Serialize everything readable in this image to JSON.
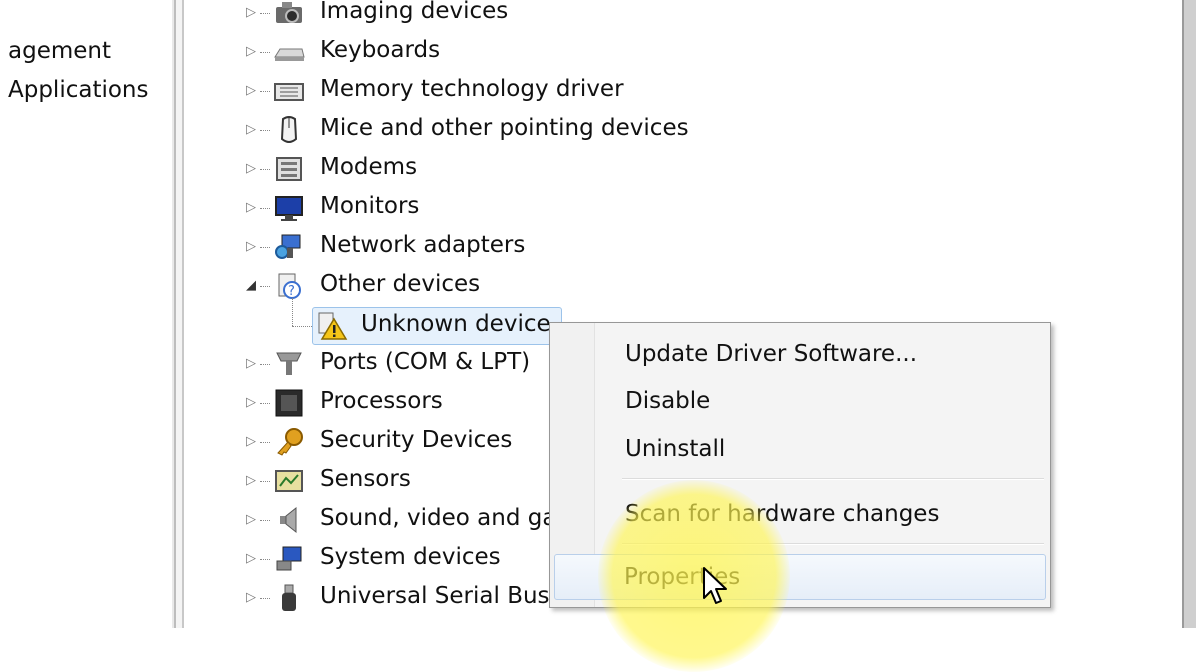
{
  "left_pane": {
    "items": [
      "agement",
      "Applications"
    ]
  },
  "tree": {
    "categories": [
      {
        "label": "Imaging devices",
        "icon": "camera-icon",
        "expanded": false
      },
      {
        "label": "Keyboards",
        "icon": "keyboard-icon",
        "expanded": false
      },
      {
        "label": "Memory technology driver",
        "icon": "memory-card-icon",
        "expanded": false
      },
      {
        "label": "Mice and other pointing devices",
        "icon": "mouse-icon",
        "expanded": false
      },
      {
        "label": "Modems",
        "icon": "modem-icon",
        "expanded": false
      },
      {
        "label": "Monitors",
        "icon": "monitor-icon",
        "expanded": false
      },
      {
        "label": "Network adapters",
        "icon": "network-adapter-icon",
        "expanded": false
      },
      {
        "label": "Other devices",
        "icon": "unknown-device-category-icon",
        "expanded": true
      },
      {
        "label": "Ports (COM & LPT)",
        "icon": "port-icon",
        "expanded": false
      },
      {
        "label": "Processors",
        "icon": "processor-icon",
        "expanded": false
      },
      {
        "label": "Security Devices",
        "icon": "key-icon",
        "expanded": false
      },
      {
        "label": "Sensors",
        "icon": "sensor-icon",
        "expanded": false
      },
      {
        "label": "Sound, video and ga",
        "icon": "speaker-icon",
        "expanded": false
      },
      {
        "label": "System devices",
        "icon": "system-device-icon",
        "expanded": false
      },
      {
        "label": "Universal Serial Bus",
        "icon": "usb-icon",
        "expanded": false
      }
    ],
    "child": {
      "label": "Unknown device",
      "icon": "warning-device-icon",
      "selected": true
    }
  },
  "context_menu": {
    "items": [
      {
        "label": "Update Driver Software...",
        "name": "update-driver-menu-item"
      },
      {
        "label": "Disable",
        "name": "disable-menu-item"
      },
      {
        "label": "Uninstall",
        "name": "uninstall-menu-item"
      },
      {
        "label": "Scan for hardware changes",
        "name": "scan-hardware-menu-item"
      },
      {
        "label": "Properties",
        "name": "properties-menu-item",
        "hovered": true
      }
    ]
  },
  "colors": {
    "selection_bg": "#e6f1fc",
    "selection_border": "#9cc3ea",
    "highlight": "#fff550"
  }
}
